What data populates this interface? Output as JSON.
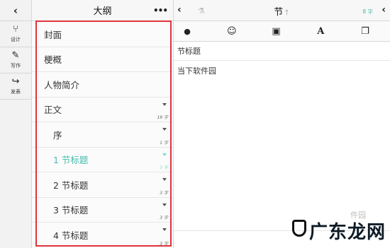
{
  "toolbar": {
    "back_icon": "chevron-left-icon",
    "tools": [
      {
        "icon": "branch-icon",
        "glyph": "⑂",
        "label": "设计"
      },
      {
        "icon": "pencil-icon",
        "glyph": "✎",
        "label": "写作"
      },
      {
        "icon": "share-icon",
        "glyph": "↪",
        "label": "发表"
      }
    ]
  },
  "outline": {
    "title": "大纲",
    "more": "•••",
    "items": [
      {
        "label": "封面",
        "count": "",
        "sub": false,
        "active": false,
        "arrow": false
      },
      {
        "label": "梗概",
        "count": "",
        "sub": false,
        "active": false,
        "arrow": false
      },
      {
        "label": "人物简介",
        "count": "",
        "sub": false,
        "active": false,
        "arrow": false
      },
      {
        "label": "正文",
        "count": "19 字",
        "sub": false,
        "active": false,
        "arrow": true
      },
      {
        "label": "序",
        "count": "1 字",
        "sub": true,
        "active": false,
        "arrow": true
      },
      {
        "label": "1 节标题",
        "count": "3 字",
        "sub": true,
        "active": true,
        "arrow": true
      },
      {
        "label": "2 节标题",
        "count": "3 字",
        "sub": true,
        "active": false,
        "arrow": true
      },
      {
        "label": "3 节标题",
        "count": "3 字",
        "sub": true,
        "active": false,
        "arrow": true
      },
      {
        "label": "4 节标题",
        "count": "3 字",
        "sub": true,
        "active": false,
        "arrow": true
      }
    ]
  },
  "editor": {
    "back": "‹",
    "title": "节",
    "title_arrow": "↑",
    "word_count": "8 字",
    "chevron": "‹",
    "tools": [
      "user-icon",
      "smiley-icon",
      "image-icon",
      "font-icon",
      "copy-icon"
    ],
    "tool_glyphs": {
      "user": "👤",
      "smiley": "☺",
      "image": "▣",
      "font": "A",
      "copy": "❐"
    },
    "section_title": "节标题",
    "body_text": "当下软件园"
  },
  "watermark": {
    "main": "广东龙网",
    "small": "件园"
  },
  "colors": {
    "accent": "#45b9ad",
    "highlight": "#e0343b"
  }
}
